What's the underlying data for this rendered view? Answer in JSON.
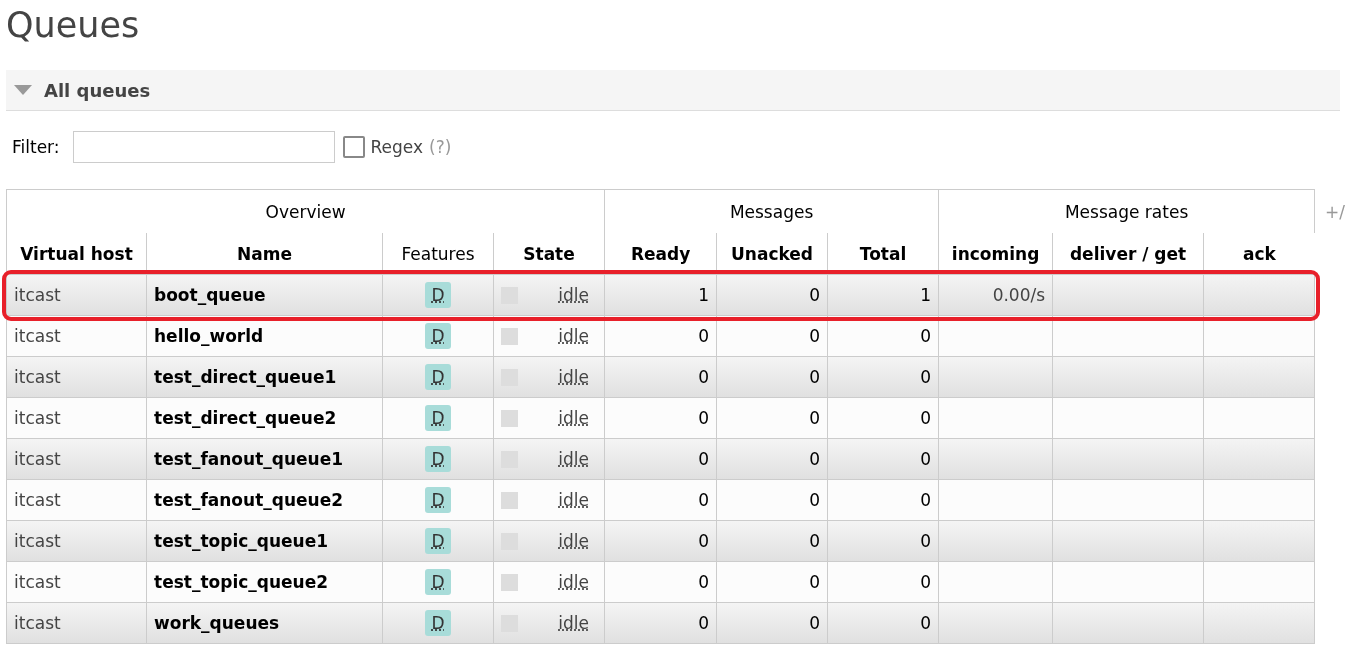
{
  "title": "Queues",
  "section": {
    "title": "All queues",
    "expanded": true
  },
  "filter": {
    "label": "Filter:",
    "regex_label": "Regex",
    "regex_checked": false,
    "help": "(?)"
  },
  "table": {
    "groups": [
      {
        "label": "Overview"
      },
      {
        "label": "Messages"
      },
      {
        "label": "Message rates"
      }
    ],
    "toggle": "+/",
    "columns": [
      {
        "label": "Virtual host",
        "bold": true
      },
      {
        "label": "Name",
        "bold": true
      },
      {
        "label": "Features",
        "bold": false
      },
      {
        "label": "State",
        "bold": true
      },
      {
        "label": "Ready",
        "bold": true
      },
      {
        "label": "Unacked",
        "bold": true
      },
      {
        "label": "Total",
        "bold": true
      },
      {
        "label": "incoming",
        "bold": true
      },
      {
        "label": "deliver / get",
        "bold": true
      },
      {
        "label": "ack",
        "bold": true
      }
    ],
    "rows": [
      {
        "vhost": "itcast",
        "name": "boot_queue",
        "feature": "D",
        "state": "idle",
        "ready": "1",
        "unacked": "0",
        "total": "1",
        "incoming": "0.00/s",
        "highlighted": true
      },
      {
        "vhost": "itcast",
        "name": "hello_world",
        "feature": "D",
        "state": "idle",
        "ready": "0",
        "unacked": "0",
        "total": "0",
        "highlighted": false
      },
      {
        "vhost": "itcast",
        "name": "test_direct_queue1",
        "feature": "D",
        "state": "idle",
        "ready": "0",
        "unacked": "0",
        "total": "0",
        "highlighted": false
      },
      {
        "vhost": "itcast",
        "name": "test_direct_queue2",
        "feature": "D",
        "state": "idle",
        "ready": "0",
        "unacked": "0",
        "total": "0",
        "highlighted": false
      },
      {
        "vhost": "itcast",
        "name": "test_fanout_queue1",
        "feature": "D",
        "state": "idle",
        "ready": "0",
        "unacked": "0",
        "total": "0",
        "highlighted": false
      },
      {
        "vhost": "itcast",
        "name": "test_fanout_queue2",
        "feature": "D",
        "state": "idle",
        "ready": "0",
        "unacked": "0",
        "total": "0",
        "highlighted": false
      },
      {
        "vhost": "itcast",
        "name": "test_topic_queue1",
        "feature": "D",
        "state": "idle",
        "ready": "0",
        "unacked": "0",
        "total": "0",
        "highlighted": false
      },
      {
        "vhost": "itcast",
        "name": "test_topic_queue2",
        "feature": "D",
        "state": "idle",
        "ready": "0",
        "unacked": "0",
        "total": "0",
        "highlighted": false
      },
      {
        "vhost": "itcast",
        "name": "work_queues",
        "feature": "D",
        "state": "idle",
        "ready": "0",
        "unacked": "0",
        "total": "0",
        "highlighted": false
      }
    ]
  }
}
